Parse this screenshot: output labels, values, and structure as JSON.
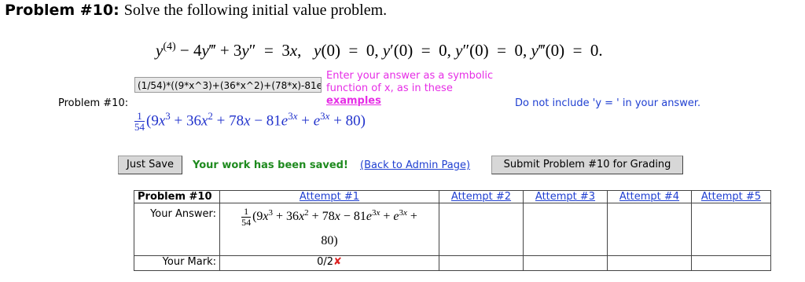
{
  "problem": {
    "title": "Problem #10:",
    "description": "Solve the following initial value problem.",
    "label": "Problem #10:"
  },
  "answer": {
    "input_value": "(1/54)*((9*x^3)+(36*x^2)+(78*x)-81e^(3x)+e^(3x)+80)",
    "hint_line1": "Enter your answer as a symbolic",
    "hint_line2": "function of x, as in these",
    "examples_link": "examples",
    "note": "Do not include 'y = ' in your answer."
  },
  "actions": {
    "save_label": "Just Save",
    "saved_message": "Your work has been saved!",
    "admin_link": "(Back to Admin Page)",
    "submit_label": "Submit Problem #10 for Grading"
  },
  "attempts": {
    "header": "Problem #10",
    "your_answer_label": "Your Answer:",
    "your_mark_label": "Your Mark:",
    "columns": [
      "Attempt #1",
      "Attempt #2",
      "Attempt #3",
      "Attempt #4",
      "Attempt #5"
    ],
    "attempt1_mark": "0/2",
    "attempt1_answer_end": "80)"
  },
  "colors": {
    "hint": "#e62ee6",
    "link": "#1f3fd1",
    "saved": "#1e8a1e",
    "wrong": "#d22"
  }
}
